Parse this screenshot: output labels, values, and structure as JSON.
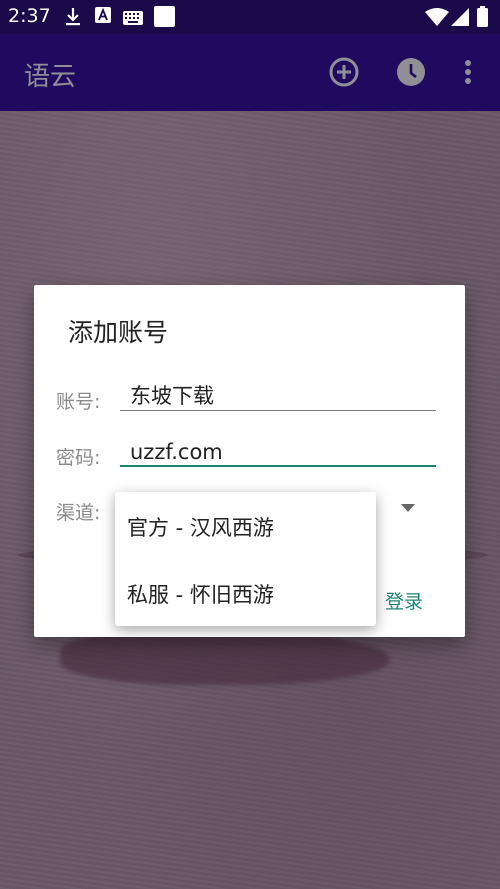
{
  "status_bar": {
    "time": "2:37",
    "icons": [
      "download-icon",
      "font-a-icon",
      "keyboard-icon",
      "square-icon",
      "wifi-icon",
      "signal-icon",
      "battery-icon"
    ]
  },
  "app_bar": {
    "title": "语云",
    "actions": [
      "add-circle-icon",
      "clock-icon",
      "more-vert-icon"
    ]
  },
  "dialog": {
    "title": "添加账号",
    "account_label": "账号:",
    "account_value": "东坡下载",
    "password_label": "密码:",
    "password_value": "uzzf.com",
    "channel_label": "渠道:",
    "login_label": "登录"
  },
  "channel_menu": {
    "items": [
      "官方 - 汉风西游",
      "私服 - 怀旧西游"
    ]
  },
  "colors": {
    "status_bar": "#1a0a4a",
    "app_bar": "#200a60",
    "accent": "#1a8577",
    "background": "#6a5866"
  }
}
